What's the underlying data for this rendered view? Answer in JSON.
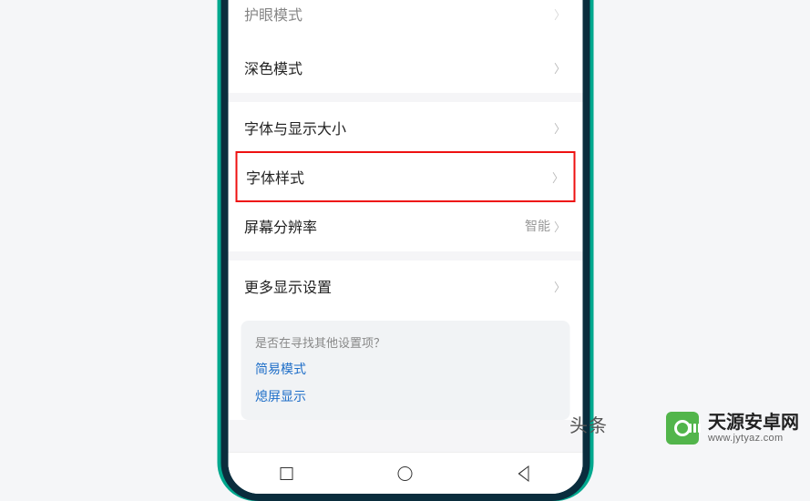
{
  "settings": {
    "rows": [
      {
        "label": "护眼模式",
        "value": ""
      },
      {
        "label": "深色模式",
        "value": ""
      },
      {
        "label": "字体与显示大小",
        "value": ""
      },
      {
        "label": "字体样式",
        "value": ""
      },
      {
        "label": "屏幕分辨率",
        "value": "智能"
      },
      {
        "label": "更多显示设置",
        "value": ""
      }
    ]
  },
  "suggestions": {
    "title": "是否在寻找其他设置项？",
    "links": [
      "简易模式",
      "熄屏显示"
    ]
  },
  "watermark": {
    "headline": "头条",
    "brand": "天源安卓网",
    "url": "www.jytyaz.com"
  }
}
